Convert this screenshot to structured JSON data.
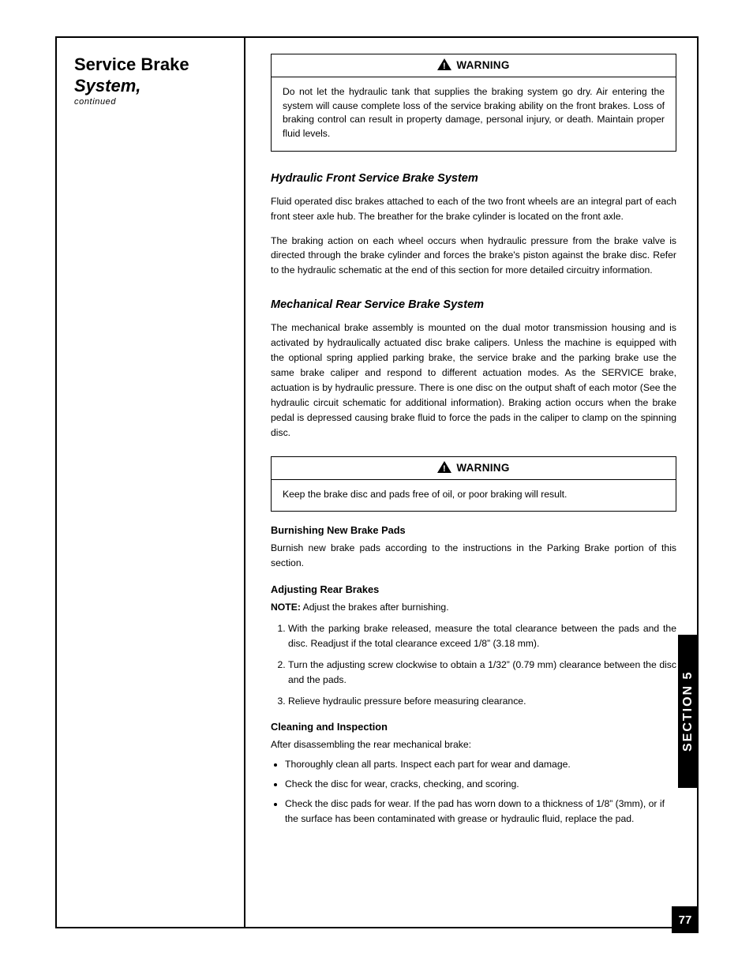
{
  "sidebar": {
    "title_line1": "Service Brake",
    "title_line2": "System,",
    "subtitle": "continued",
    "tab_label": "SECTION 5"
  },
  "hydraulic": {
    "warning": {
      "label": "WARNING",
      "body": "Do not let the hydraulic tank that supplies the braking system go dry. Air entering the system will cause complete loss of the service brak­ing ability on the front brakes. Loss of braking control can result in prop­erty damage, personal injury, or death. Maintain proper fluid levels."
    },
    "heading": "Hydraulic Front Service Brake System",
    "para1": "Fluid operated disc brakes attached to each of the two front wheels are an integral part of each front steer axle hub. The breather for the brake cylinder is located on the front axle.",
    "para2": "The braking action on each wheel occurs when hydraulic pressure from the brake valve is directed through the brake cylinder and forces the brake's piston against the brake disc. Refer to the hydraulic schematic at the end of this section for more de­tailed circuitry information."
  },
  "mechanical": {
    "heading": "Mechanical Rear Service Brake System",
    "para1": "The mechanical brake assembly is mounted on the dual motor transmission housing and is activated by hydraulically actuated disc brake calipers. Unless the machine is equipped with the optional spring applied parking brake, the service brake and the parking brake use the same brake caliper and respond to different actuation modes. As the SERVICE brake, actuation is by hydraulic pres­sure. There is one disc on the output shaft of each motor (See the hydraulic cir­cuit schematic for additional information). Braking action occurs when the brake pedal is depressed causing brake fluid to force the pads in the caliper to clamp on the spinning disc.",
    "warning": {
      "label": "WARNING",
      "body": "Keep the brake disc and pads free of oil, or poor braking will result."
    },
    "sub1": {
      "head": "Burnishing New Brake Pads",
      "body": "Burnish new brake pads according to the instructions in the Parking Brake portion of this section."
    },
    "sub2": {
      "head": "Adjusting Rear Brakes",
      "note_label": "NOTE:",
      "note_body": "Adjust the brakes after burnishing.",
      "steps": [
        "With the parking brake released, measure the total clearance between the pads and the disc. Readjust if the total clearance exceed 1/8” (3.18 mm).",
        "Turn the adjusting screw clockwise to obtain a 1/32” (0.79 mm) clearance between the disc and the pads.",
        "Relieve hydraulic pressure before measuring clearance."
      ]
    },
    "sub3": {
      "head": "Cleaning and Inspection",
      "intro": "After disassembling the rear mechanical brake:",
      "bullets": [
        "Thoroughly clean all parts. Inspect each part for wear and damage.",
        "Check the disc for wear, cracks, checking, and scoring.",
        "Check the disc pads for wear. If the pad has worn down to a thickness of 1/8” (3mm), or if the sur­face has been contaminated with grease or hydraulic fluid, re­place the pad."
      ]
    }
  },
  "page_number": "77"
}
